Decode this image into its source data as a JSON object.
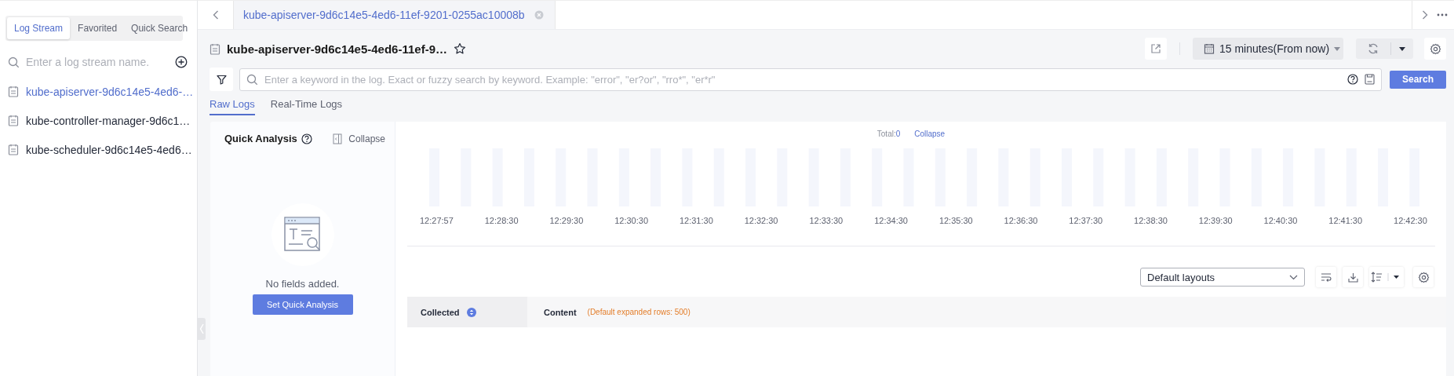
{
  "sidebar": {
    "tabs": [
      {
        "label": "Log Stream",
        "selected": true
      },
      {
        "label": "Favorited",
        "selected": false
      },
      {
        "label": "Quick Search",
        "selected": false
      }
    ],
    "search": {
      "placeholder": "Enter a log stream name."
    },
    "streams": [
      {
        "name": "kube-apiserver-9d6c14e5-4ed6-…",
        "selected": true
      },
      {
        "name": "kube-controller-manager-9d6c1…",
        "selected": false
      },
      {
        "name": "kube-scheduler-9d6c14e5-4ed6…",
        "selected": false
      }
    ]
  },
  "tab_bar": {
    "tabs": [
      {
        "label": "kube-apiserver-9d6c14e5-4ed6-11ef-9201-0255ac10008b",
        "selected": true
      }
    ]
  },
  "header": {
    "title": "kube-apiserver-9d6c14e5-4ed6-11ef-9…",
    "time_range": "15 minutes(From now)"
  },
  "search": {
    "placeholder": "Enter a keyword in the log. Exact or fuzzy search by keyword. Example: \"error\", \"er?or\", \"rro*\", \"er*r\"",
    "button": "Search"
  },
  "view_tabs": [
    {
      "label": "Raw Logs",
      "selected": true
    },
    {
      "label": "Real-Time Logs",
      "selected": false
    }
  ],
  "quick_analysis": {
    "title": "Quick Analysis",
    "collapse": "Collapse",
    "empty_text": "No fields added.",
    "button": "Set Quick Analysis"
  },
  "histogram": {
    "total_label": "Total:",
    "total": "0",
    "collapse": "Collapse",
    "time_labels": [
      "12:27:57",
      "12:28:30",
      "12:29:30",
      "12:30:30",
      "12:31:30",
      "12:32:30",
      "12:33:30",
      "12:34:30",
      "12:35:30",
      "12:36:30",
      "12:37:30",
      "12:38:30",
      "12:39:30",
      "12:40:30",
      "12:41:30",
      "12:42:30"
    ]
  },
  "layout_select": {
    "value": "Default layouts"
  },
  "table": {
    "columns": [
      {
        "label": "Collected",
        "sortable": true
      },
      {
        "label": "Content",
        "note": "(Default expanded rows: 500)"
      }
    ]
  }
}
